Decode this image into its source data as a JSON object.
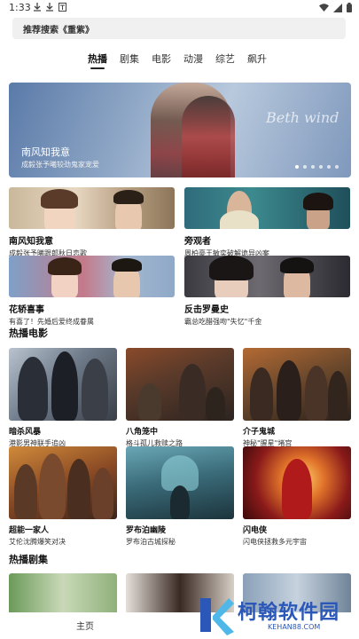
{
  "status_bar": {
    "time": "1:33",
    "icons": [
      "download-icon",
      "download-icon",
      "text-icon"
    ],
    "right_icons": [
      "wifi-icon",
      "signal-icon",
      "battery-icon"
    ]
  },
  "search": {
    "placeholder": "推荐搜索《重紫》"
  },
  "tabs": [
    {
      "label": "热播",
      "active": true
    },
    {
      "label": "剧集",
      "active": false
    },
    {
      "label": "电影",
      "active": false
    },
    {
      "label": "动漫",
      "active": false
    },
    {
      "label": "综艺",
      "active": false
    },
    {
      "label": "飙升",
      "active": false
    }
  ],
  "banner": {
    "title": "南风知我意",
    "subtitle": "成毅张予曦较劲鬼家宠爱",
    "script_text": "Beth wind",
    "dots": 6,
    "active_dot": 0
  },
  "featured": [
    {
      "title": "南风知我意",
      "subtitle": "成毅张予曦跟郎秋日恋歌"
    },
    {
      "title": "旁观者",
      "subtitle": "周柏豪王敏奕破解诡异凶案"
    },
    {
      "title": "花轿喜事",
      "subtitle": "有喜了！先婚后爱终成眷属"
    },
    {
      "title": "反击罗曼史",
      "subtitle": "霸总吃醋强吻\"失忆\"千金"
    }
  ],
  "movies_section": {
    "title": "热播电影",
    "items": [
      {
        "title": "暗杀风暴",
        "subtitle": "港影男神联手追凶"
      },
      {
        "title": "八角笼中",
        "subtitle": "格斗孤儿救赎之路"
      },
      {
        "title": "介子鬼城",
        "subtitle": "神秘\"腥星\"堵宫"
      },
      {
        "title": "超能一家人",
        "subtitle": "艾伦沈腾爆笑对决"
      },
      {
        "title": "罗布泊幽陵",
        "subtitle": "罗布泊古城探秘"
      },
      {
        "title": "闪电侠",
        "subtitle": "闪电侠拯救多元宇宙"
      }
    ]
  },
  "series_section": {
    "title": "热播剧集"
  },
  "bottom_nav": {
    "home": "主页"
  },
  "watermark": {
    "name": "柯翰软件园",
    "url": "KEHAN88.COM"
  },
  "colors": {
    "accent": "#2a57b8",
    "search_bg": "#f0f0f0"
  }
}
